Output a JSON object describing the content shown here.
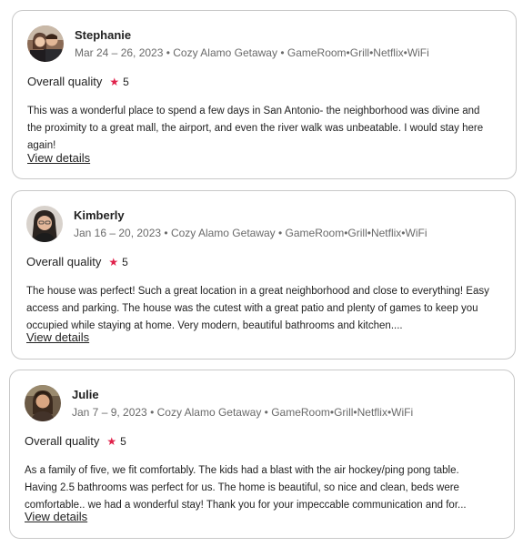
{
  "reviews": [
    {
      "name": "Stephanie",
      "meta": "Mar 24 – 26, 2023 • Cozy Alamo Getaway • GameRoom•Grill•Netflix•WiFi",
      "quality_label": "Overall quality",
      "rating": "5",
      "text": "This was a wonderful place to spend a few days in San Antonio- the neighborhood was divine and the proximity to a great mall, the airport, and even the river walk was unbeatable. I would stay here again!",
      "details_label": "View details"
    },
    {
      "name": "Kimberly",
      "meta": "Jan 16 – 20, 2023 • Cozy Alamo Getaway • GameRoom•Grill•Netflix•WiFi",
      "quality_label": "Overall quality",
      "rating": "5",
      "text": "The house was perfect! Such a great location in a great neighborhood and close to everything! Easy access and parking. The house was the cutest with a great patio and plenty of games to keep you occupied while staying at home. Very modern, beautiful bathrooms and kitchen....",
      "details_label": "View details"
    },
    {
      "name": "Julie",
      "meta": "Jan 7 – 9, 2023 • Cozy Alamo Getaway • GameRoom•Grill•Netflix•WiFi",
      "quality_label": "Overall quality",
      "rating": "5",
      "text": "As a family of five, we fit comfortably. The kids had a blast with the air hockey/ping pong table. Having 2.5 bathrooms was perfect for us. The home is beautiful, so nice and clean, beds were comfortable.. we had a wonderful stay! Thank you for your impeccable communication and for...",
      "details_label": "View details"
    }
  ],
  "icons": {
    "rating": "star-icon"
  },
  "colors": {
    "star": "#e0214a",
    "border": "#c8c8c8",
    "meta_text": "#6a6a6a"
  }
}
